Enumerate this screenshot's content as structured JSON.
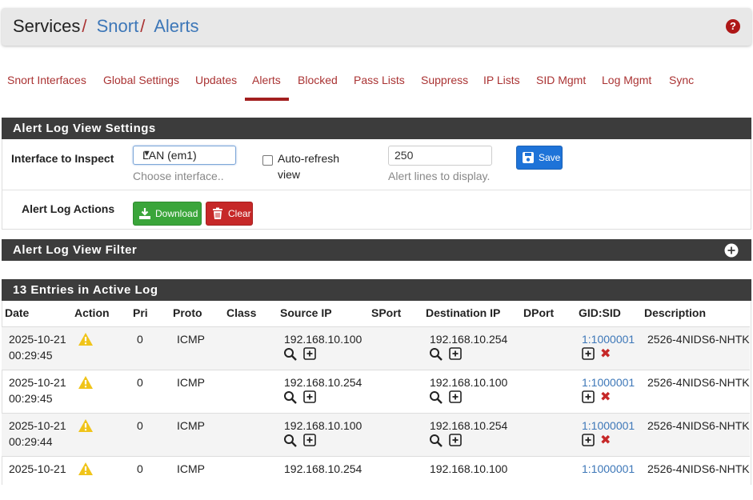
{
  "breadcrumb": {
    "items": [
      "Services",
      "Snort",
      "Alerts"
    ],
    "separator": "/"
  },
  "help_icon": "?",
  "tabs": [
    "Snort Interfaces",
    "Global Settings",
    "Updates",
    "Alerts",
    "Blocked",
    "Pass Lists",
    "Suppress",
    "IP Lists",
    "SID Mgmt",
    "Log Mgmt",
    "Sync"
  ],
  "active_tab": "Alerts",
  "settings_panel": {
    "title": "Alert Log View Settings",
    "interface_label": "Interface to Inspect",
    "interface_value": "LAN (em1)",
    "interface_help": "Choose interface..",
    "autorefresh_label_1": "Auto-refresh",
    "autorefresh_label_2": "view",
    "autorefresh_checked": false,
    "lines_value": "250",
    "lines_help": "Alert lines to display.",
    "save_label": "Save",
    "actions_label": "Alert Log Actions",
    "download_label": "Download",
    "clear_label": "Clear"
  },
  "filter_panel": {
    "title": "Alert Log View Filter"
  },
  "log_panel": {
    "title": "13 Entries in Active Log",
    "columns": [
      "Date",
      "Action",
      "Pri",
      "Proto",
      "Class",
      "Source IP",
      "SPort",
      "Destination IP",
      "DPort",
      "GID:SID",
      "Description"
    ],
    "rows": [
      {
        "date": "2025-10-21",
        "time": "00:29:45",
        "pri": "0",
        "proto": "ICMP",
        "class": "",
        "src": "192.168.10.100",
        "sport": "",
        "dst": "192.168.10.254",
        "dport": "",
        "gidsid": "1:1000001",
        "desc": "2526-4NIDS6-NHTK"
      },
      {
        "date": "2025-10-21",
        "time": "00:29:45",
        "pri": "0",
        "proto": "ICMP",
        "class": "",
        "src": "192.168.10.254",
        "sport": "",
        "dst": "192.168.10.100",
        "dport": "",
        "gidsid": "1:1000001",
        "desc": "2526-4NIDS6-NHTK"
      },
      {
        "date": "2025-10-21",
        "time": "00:29:44",
        "pri": "0",
        "proto": "ICMP",
        "class": "",
        "src": "192.168.10.100",
        "sport": "",
        "dst": "192.168.10.254",
        "dport": "",
        "gidsid": "1:1000001",
        "desc": "2526-4NIDS6-NHTK"
      },
      {
        "date": "2025-10-21",
        "time": "",
        "pri": "0",
        "proto": "ICMP",
        "class": "",
        "src": "192.168.10.254",
        "sport": "",
        "dst": "192.168.10.100",
        "dport": "",
        "gidsid": "1:1000001",
        "desc": "2526-4NIDS6-NHTK"
      }
    ]
  },
  "colors": {
    "link": "#3d77b8",
    "accent_red": "#a33",
    "panel_header": "#3c3c3c",
    "save_blue": "#1e73d8",
    "download_green": "#3aa53a",
    "clear_red": "#c62828",
    "warning_yellow": "#f0c419"
  }
}
